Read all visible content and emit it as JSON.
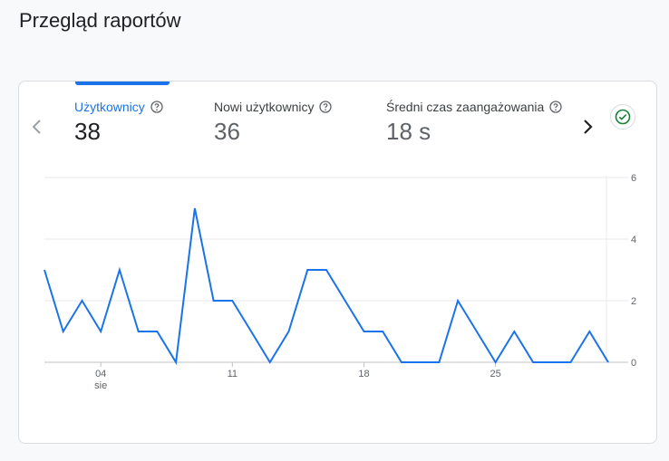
{
  "page": {
    "title": "Przegląd raportów"
  },
  "metrics": [
    {
      "label": "Użytkownicy",
      "value": "38"
    },
    {
      "label": "Nowi użytkownicy",
      "value": "36"
    },
    {
      "label": "Średni czas zaangażowania",
      "value": "18 s"
    }
  ],
  "colors": {
    "accent": "#1a73e8",
    "check": "#188038"
  },
  "icons": {
    "help": "help-circle-icon",
    "prev": "chevron-left-icon",
    "next": "chevron-right-icon",
    "check": "check-circle-icon"
  },
  "chart_data": {
    "type": "line",
    "x_ticks": [
      "04",
      "11",
      "18",
      "25"
    ],
    "x_tick_sub": "sie",
    "y_ticks": [
      "0",
      "2",
      "4",
      "6"
    ],
    "ylim": [
      0,
      6
    ],
    "grid": true,
    "series": [
      {
        "values": [
          3,
          1,
          2,
          1,
          3,
          1,
          1,
          0,
          5,
          2,
          2,
          1,
          0,
          1,
          3,
          3,
          2,
          1,
          1,
          0,
          0,
          0,
          2,
          1,
          0,
          1,
          0,
          0,
          0,
          1,
          0
        ]
      }
    ]
  }
}
